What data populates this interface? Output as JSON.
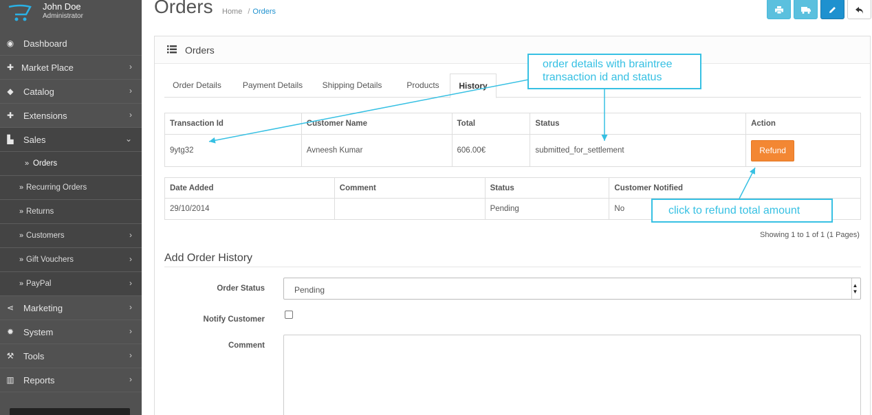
{
  "profile": {
    "name": "John Doe",
    "role": "Administrator"
  },
  "sidebar": {
    "items": [
      {
        "label": "Dashboard",
        "icon": "dashboard-icon"
      },
      {
        "label": "Market Place",
        "icon": "puzzle-icon"
      },
      {
        "label": "Catalog",
        "icon": "tag-icon"
      },
      {
        "label": "Extensions",
        "icon": "puzzle-icon"
      },
      {
        "label": "Sales",
        "icon": "cart-icon"
      },
      {
        "label": "Orders",
        "icon": "double-chevron-icon"
      },
      {
        "label": "Recurring Orders",
        "icon": "double-chevron-icon"
      },
      {
        "label": "Returns",
        "icon": "double-chevron-icon"
      },
      {
        "label": "Customers",
        "icon": "double-chevron-icon"
      },
      {
        "label": "Gift Vouchers",
        "icon": "double-chevron-icon"
      },
      {
        "label": "PayPal",
        "icon": "double-chevron-icon"
      },
      {
        "label": "Marketing",
        "icon": "share-icon"
      },
      {
        "label": "System",
        "icon": "gear-icon"
      },
      {
        "label": "Tools",
        "icon": "wrench-icon"
      },
      {
        "label": "Reports",
        "icon": "bar-chart-icon"
      }
    ]
  },
  "header": {
    "title": "Orders",
    "breadcrumb": {
      "home": "Home",
      "sep": "/",
      "current": "Orders"
    }
  },
  "panel": {
    "title": "Orders"
  },
  "tabs": [
    "Order Details",
    "Payment Details",
    "Shipping Details",
    "Products",
    "History"
  ],
  "transaction_table": {
    "headers": [
      "Transaction Id",
      "Customer Name",
      "Total",
      "Status",
      "Action"
    ],
    "row": {
      "id": "9ytg32",
      "customer": "Avneesh Kumar",
      "total": "606.00€",
      "status": "submitted_for_settlement",
      "action": "Refund"
    }
  },
  "history_table": {
    "headers": [
      "Date Added",
      "Comment",
      "Status",
      "Customer Notified"
    ],
    "row": {
      "date": "29/10/2014",
      "comment": "",
      "status": "Pending",
      "notified": "No"
    }
  },
  "pagination": "Showing 1 to 1 of 1 (1 Pages)",
  "add_history": {
    "title": "Add Order History",
    "order_status_label": "Order Status",
    "order_status_value": "Pending",
    "notify_label": "Notify Customer",
    "comment_label": "Comment"
  },
  "annotations": {
    "order_details_line1": "order details with braintree",
    "order_details_line2": "transaction id and status",
    "refund": "click to refund total amount"
  },
  "colors": {
    "sidebar": "#515151",
    "accent": "#1e91cf",
    "info": "#5bc0de",
    "refund": "#f38733",
    "annotation": "#36c0e3"
  }
}
